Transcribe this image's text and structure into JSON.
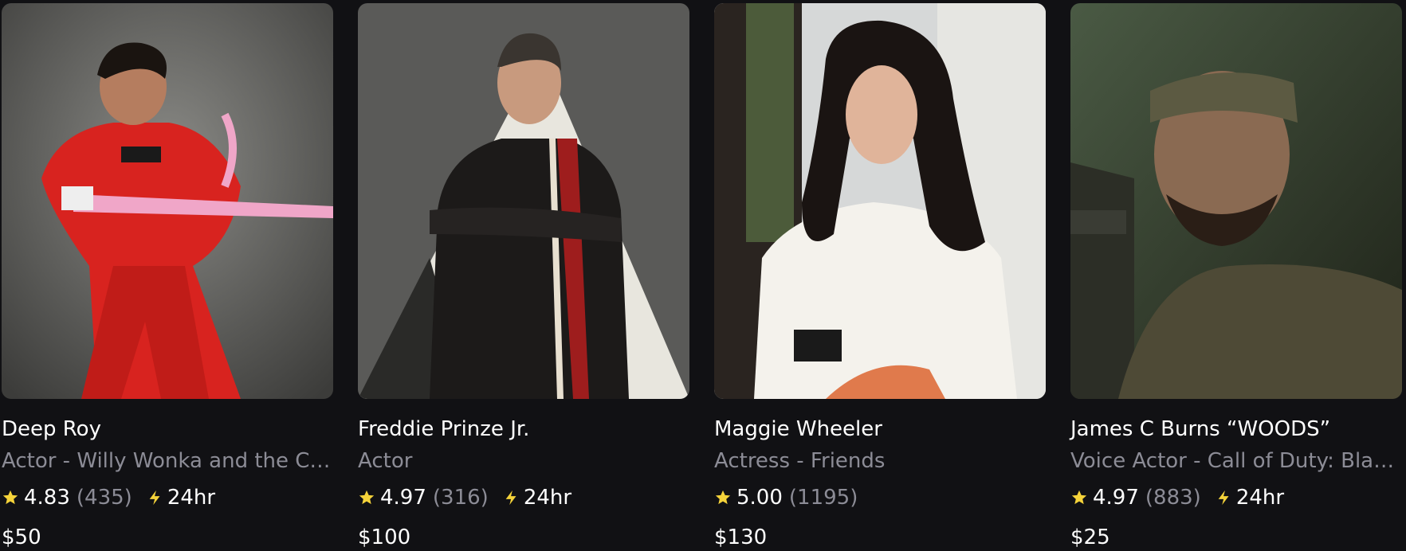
{
  "colors": {
    "background": "#111114",
    "text_primary": "#ffffff",
    "text_secondary": "#8c8c96",
    "star": "#f5d33a",
    "bolt": "#f5d33a"
  },
  "icons": {
    "rating": "star-icon",
    "response_time": "lightning-bolt-icon"
  },
  "cards": [
    {
      "name": "Deep Roy",
      "role": "Actor - Willy Wonka and the Chocolate Factory",
      "rating": "4.83",
      "reviews": "(435)",
      "response": "24hr",
      "price": "$50"
    },
    {
      "name": "Freddie Prinze Jr.",
      "role": "Actor",
      "rating": "4.97",
      "reviews": "(316)",
      "response": "24hr",
      "price": "$100"
    },
    {
      "name": "Maggie Wheeler",
      "role": "Actress - Friends",
      "rating": "5.00",
      "reviews": "(1195)",
      "response": "",
      "price": "$130"
    },
    {
      "name": "James C Burns “WOODS”",
      "role": "Voice Actor - Call of Duty: Black Ops",
      "rating": "4.97",
      "reviews": "(883)",
      "response": "24hr",
      "price": "$25"
    }
  ]
}
